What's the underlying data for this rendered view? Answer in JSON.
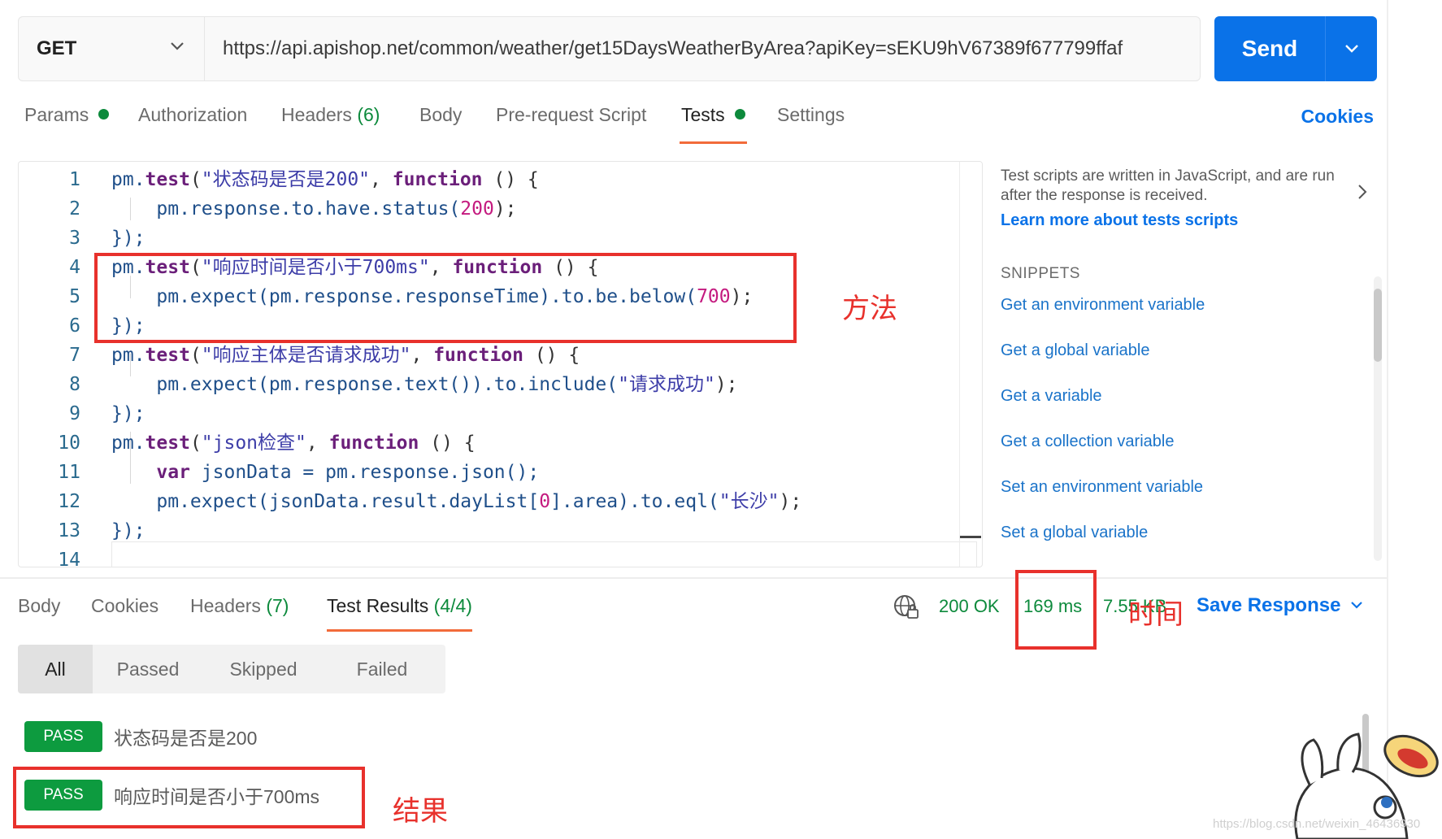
{
  "request": {
    "method": "GET",
    "url": "https://api.apishop.net/common/weather/get15DaysWeatherByArea?apiKey=sEKU9hV67389f677799ffaf",
    "send_label": "Send"
  },
  "request_tabs": {
    "params": "Params",
    "authorization": "Authorization",
    "headers": "Headers",
    "headers_count": "(6)",
    "body": "Body",
    "prerequest": "Pre-request Script",
    "tests": "Tests",
    "settings": "Settings",
    "cookies": "Cookies"
  },
  "editor": {
    "lines": [
      {
        "n": "1"
      },
      {
        "n": "2"
      },
      {
        "n": "3"
      },
      {
        "n": "4"
      },
      {
        "n": "5"
      },
      {
        "n": "6"
      },
      {
        "n": "7"
      },
      {
        "n": "8"
      },
      {
        "n": "9"
      },
      {
        "n": "10"
      },
      {
        "n": "11"
      },
      {
        "n": "12"
      },
      {
        "n": "13"
      },
      {
        "n": "14"
      }
    ],
    "tokens": {
      "l1": [
        "pm.",
        "test",
        "(",
        "\"状态码是否是200\"",
        ", ",
        "function",
        " () {"
      ],
      "l2": [
        "    pm.response.to.have.status(",
        "200",
        ");"
      ],
      "l3": [
        "});"
      ],
      "l4": [
        "pm.",
        "test",
        "(",
        "\"响应时间是否小于700ms\"",
        ", ",
        "function",
        " () {"
      ],
      "l5": [
        "    pm.expect(pm.response.responseTime).to.be.below(",
        "700",
        ");"
      ],
      "l6": [
        "});"
      ],
      "l7": [
        "pm.",
        "test",
        "(",
        "\"响应主体是否请求成功\"",
        ", ",
        "function",
        " () {"
      ],
      "l8": [
        "    pm.expect(pm.response.text()).to.include(",
        "\"请求成功\"",
        ");"
      ],
      "l9": [
        "});"
      ],
      "l10": [
        "pm.",
        "test",
        "(",
        "\"json检查\"",
        ", ",
        "function",
        " () {"
      ],
      "l11": [
        "    ",
        "var",
        " jsonData = pm.response.json();"
      ],
      "l12": [
        "    pm.expect(jsonData.result.dayList[",
        "0",
        "].area).to.eql(",
        "\"长沙\"",
        ");"
      ],
      "l13": [
        "});"
      ],
      "l14": [
        ""
      ]
    }
  },
  "side_panel": {
    "help_text": "Test scripts are written in JavaScript, and are run after the response is received.",
    "learn_more": "Learn more about tests scripts",
    "snippets_heading": "SNIPPETS",
    "snippets": [
      "Get an environment variable",
      "Get a global variable",
      "Get a variable",
      "Get a collection variable",
      "Set an environment variable",
      "Set a global variable"
    ]
  },
  "response": {
    "tabs": {
      "body": "Body",
      "cookies": "Cookies",
      "headers": "Headers",
      "headers_count": "(7)",
      "test_results": "Test Results",
      "test_results_count": "(4/4)"
    },
    "status": "200 OK",
    "time": "169 ms",
    "size": "7.55 KB",
    "save_response": "Save Response",
    "filters": [
      "All",
      "Passed",
      "Skipped",
      "Failed"
    ],
    "results": [
      {
        "badge": "PASS",
        "name": "状态码是否是200"
      },
      {
        "badge": "PASS",
        "name": "响应时间是否小于700ms"
      }
    ]
  },
  "annotations": {
    "method": "方法",
    "time": "时间",
    "result": "结果"
  },
  "watermark": "https://blog.csdn.net/weixin_46436930",
  "colors": {
    "accent_blue": "#0a72e8",
    "success_green": "#0d8a3c",
    "pass_badge": "#0d9b3f",
    "active_tab_underline": "#f26b3a",
    "annotation_red": "#e8312c"
  }
}
